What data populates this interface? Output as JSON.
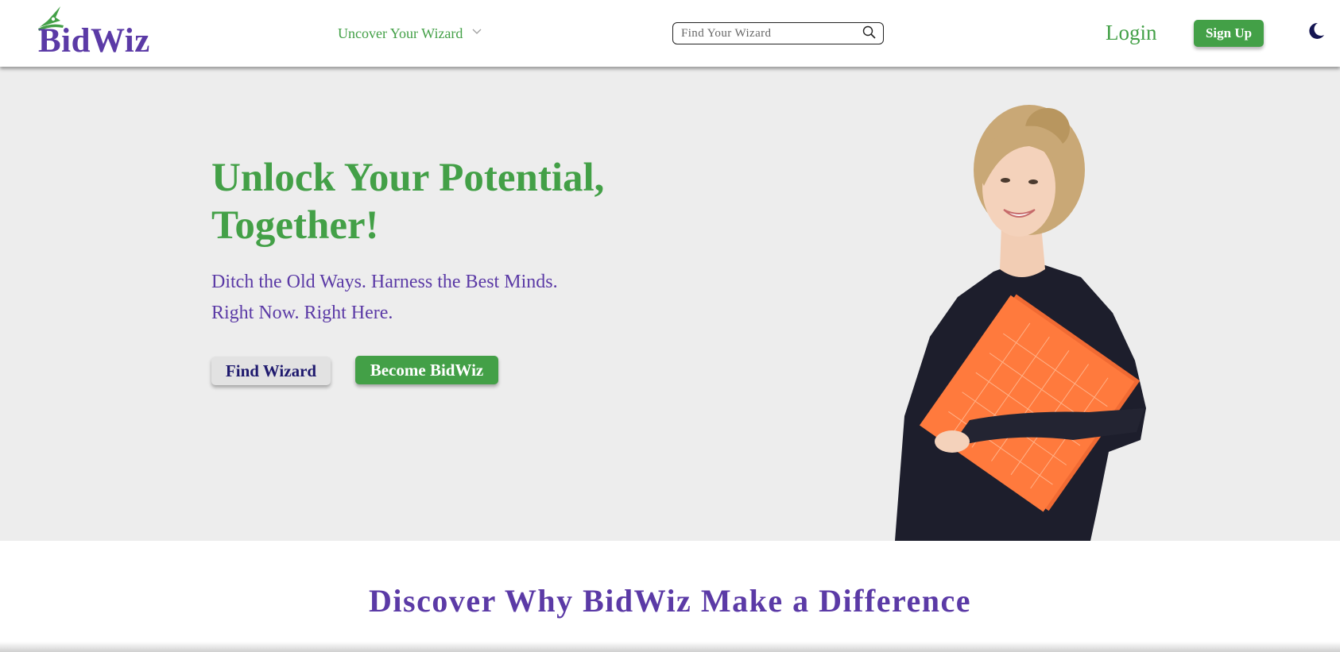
{
  "brand": {
    "name": "BidWiz",
    "logo_icon": "wizard-hat-icon"
  },
  "nav": {
    "menu_label": "Uncover Your Wizard",
    "menu_icon": "chevron-down-icon",
    "search": {
      "placeholder": "Find Your Wizard",
      "icon": "search-icon"
    },
    "login_label": "Login",
    "signup_label": "Sign Up",
    "theme_toggle_icon": "moon-icon"
  },
  "hero": {
    "title": "Unlock Your Potential, Together!",
    "subtitle_line1": "Ditch the Old Ways. Harness the Best Minds.",
    "subtitle_line2": "Right Now. Right Here.",
    "find_button": "Find Wizard",
    "become_button": "Become BidWiz",
    "image_alt": "smiling woman holding an orange folder"
  },
  "section": {
    "title": "Discover Why BidWiz Make a Difference"
  },
  "colors": {
    "brand_green": "#43a047",
    "brand_purple": "#5b3aa6",
    "hero_background": "#ededed",
    "navy": "#1f1a6e"
  }
}
